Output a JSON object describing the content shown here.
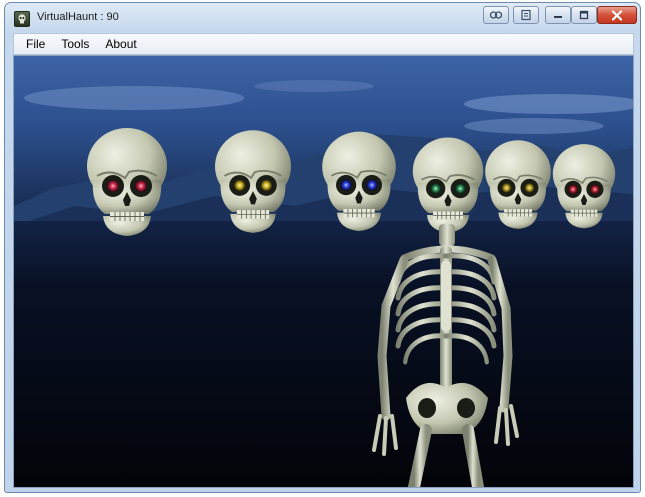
{
  "window": {
    "title": "VirtualHaunt : 90",
    "icon": "skull-app-icon",
    "controls": [
      "extra-button-1-icon",
      "extra-button-2-icon",
      "minimize-icon",
      "maximize-icon",
      "close-icon"
    ]
  },
  "menu": {
    "items": [
      {
        "label": "File"
      },
      {
        "label": "Tools"
      },
      {
        "label": "About"
      }
    ]
  },
  "scene": {
    "description_icon": "3d-scene",
    "skull_eye_colors": [
      "#c8284a",
      "#c9b227",
      "#2b3fe0",
      "#2a8a55",
      "#b4a028",
      "#c0283a"
    ],
    "sky_color": "#2c4f8c",
    "ground_color": "#05080f",
    "bone_color": "#c9ccb8"
  }
}
